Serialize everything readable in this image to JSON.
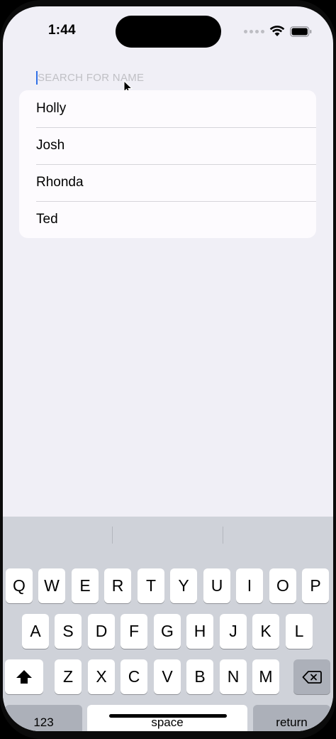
{
  "status_bar": {
    "time": "1:44"
  },
  "search": {
    "placeholder": "SEARCH FOR NAME",
    "value": ""
  },
  "names": [
    "Holly",
    "Josh",
    "Rhonda",
    "Ted"
  ],
  "keyboard": {
    "row1": [
      "Q",
      "W",
      "E",
      "R",
      "T",
      "Y",
      "U",
      "I",
      "O",
      "P"
    ],
    "row2": [
      "A",
      "S",
      "D",
      "F",
      "G",
      "H",
      "J",
      "K",
      "L"
    ],
    "row3": [
      "Z",
      "X",
      "C",
      "V",
      "B",
      "N",
      "M"
    ],
    "numbers_label": "123",
    "space_label": "space",
    "return_label": "return",
    "shift_icon": "shift-icon",
    "delete_icon": "delete-backward-icon"
  },
  "colors": {
    "accent": "#2f6fe6",
    "background": "#f0eff6",
    "keyboard": "#cfd2d9"
  }
}
